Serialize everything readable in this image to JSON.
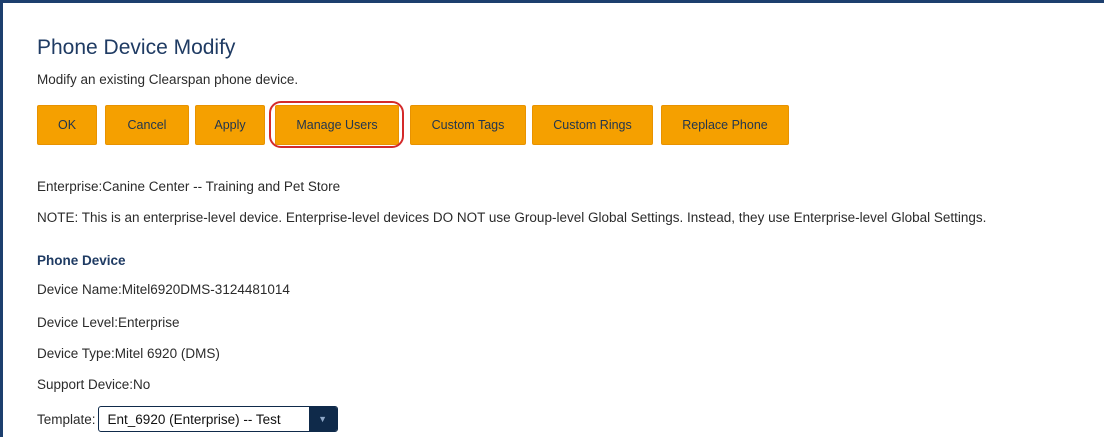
{
  "page": {
    "title": "Phone Device Modify",
    "subtitle": "Modify an existing Clearspan phone device."
  },
  "toolbar": {
    "buttons": [
      {
        "label": "OK"
      },
      {
        "label": "Cancel"
      },
      {
        "label": "Apply"
      },
      {
        "label": "Manage Users"
      },
      {
        "label": "Custom Tags"
      },
      {
        "label": "Custom Rings"
      },
      {
        "label": "Replace Phone"
      }
    ],
    "highlighted": "Manage Users"
  },
  "info": {
    "enterprise": "Enterprise:Canine Center -- Training and Pet Store",
    "note": "NOTE:  This is an enterprise-level device.  Enterprise-level devices DO NOT use Group-level Global Settings.  Instead, they use Enterprise-level Global Settings."
  },
  "phone_device": {
    "heading": "Phone Device",
    "device_name": "Device Name:Mitel6920DMS-3124481014",
    "device_level": "Device Level:Enterprise",
    "device_type": "Device Type:Mitel 6920 (DMS)",
    "support_device": "Support Device:No",
    "template_label": "Template:",
    "template_value": "Ent_6920 (Enterprise) -- Test"
  },
  "colors": {
    "button_bg": "#f5a000",
    "title": "#1f3b63",
    "highlight_ring": "#d42a2a",
    "frame_border": "#1d3f6e"
  }
}
